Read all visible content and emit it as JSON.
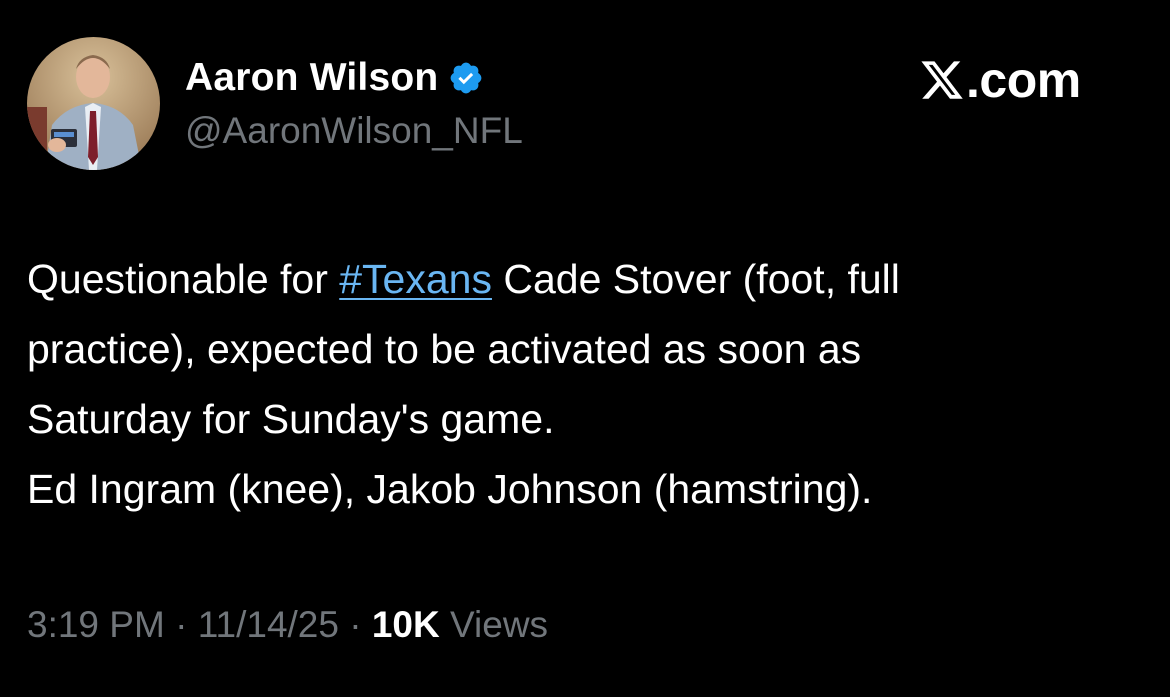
{
  "author": {
    "display_name": "Aaron Wilson",
    "handle": "@AaronWilson_NFL",
    "verified": true
  },
  "brand": {
    "text": ".com",
    "logo_icon": "x-logo-icon"
  },
  "tweet": {
    "lines": [
      {
        "before": "Questionable for ",
        "hashtag": "#Texans",
        "after": " Cade Stover (foot, full"
      },
      {
        "text": "practice), expected to be activated as soon as"
      },
      {
        "text": "Saturday for Sunday's game."
      },
      {
        "text": "Ed Ingram (knee), Jakob Johnson (hamstring)."
      }
    ]
  },
  "meta": {
    "time": "3:19 PM",
    "separator": "·",
    "date": "11/14/25",
    "views_count": "10K",
    "views_label": "Views"
  },
  "colors": {
    "background": "#000000",
    "text": "#ffffff",
    "secondary": "#71767b",
    "link": "#6ab6f2",
    "verified": "#1d9bf0"
  }
}
